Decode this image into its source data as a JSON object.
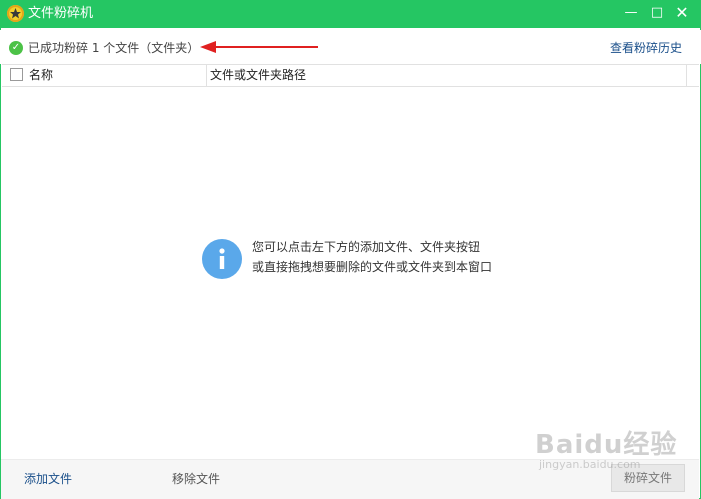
{
  "window": {
    "title": "文件粉碎机",
    "minimize_glyph": "—",
    "maximize_glyph": "□",
    "close_glyph": "✕"
  },
  "status": {
    "message": "已成功粉碎 1 个文件（文件夹）",
    "history_link": "查看粉碎历史"
  },
  "table": {
    "columns": [
      "名称",
      "文件或文件夹路径"
    ]
  },
  "empty_hint": {
    "line1": "您可以点击左下方的添加文件、文件夹按钮",
    "line2": "或直接拖拽想要删除的文件或文件夹到本窗口"
  },
  "footer": {
    "add_label": "添加文件",
    "remove_label": "移除文件",
    "shred_label": "粉碎文件"
  },
  "watermark": {
    "logo": "Baidu经验",
    "sub": "jingyan.baidu.com"
  },
  "colors": {
    "accent": "#25c663",
    "link": "#1a4f8a",
    "arrow": "#e02020",
    "info_icon": "#5aa8ea"
  }
}
